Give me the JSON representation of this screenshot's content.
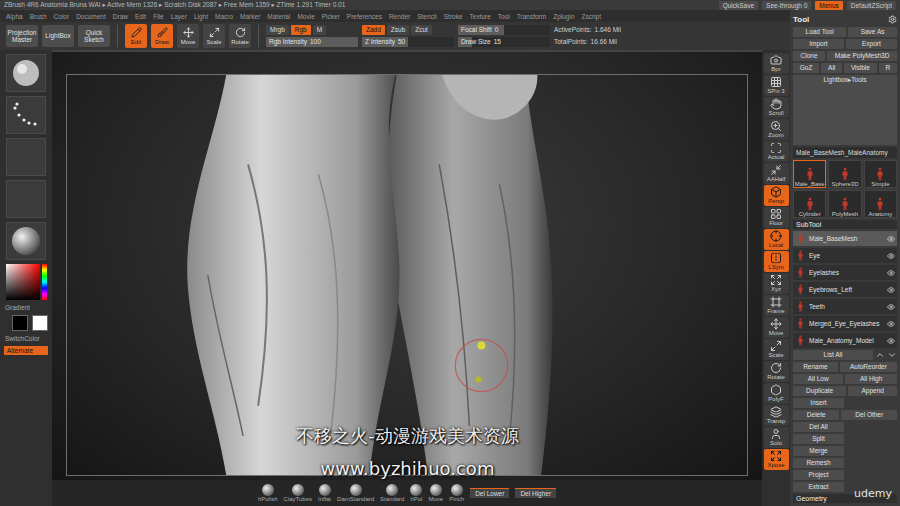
{
  "window": {
    "title": "ZBrush 4R6   Anatomia Bruna WAI  ▸ Active Mem 1326 ▸ Scratch Disk 2087 ▸ Free Mem 1359 ▸ ZTime 1.291 Timer 0.01"
  },
  "title_buttons": [
    {
      "label": "QuickSave",
      "selected": false
    },
    {
      "label": "See-through 0",
      "selected": false
    },
    {
      "label": "Menus",
      "selected": true
    },
    {
      "label": "DefaultZScript",
      "selected": false
    }
  ],
  "menu": [
    "Alpha",
    "Brush",
    "Color",
    "Document",
    "Draw",
    "Edit",
    "File",
    "Layer",
    "Light",
    "Macro",
    "Marker",
    "Material",
    "Movie",
    "Picker",
    "Preferences",
    "Render",
    "Stencil",
    "Stroke",
    "Texture",
    "Tool",
    "Transform",
    "Zplugin",
    "Zscript"
  ],
  "toolbar": {
    "buttons": [
      "Projection Master",
      "LightBox",
      "Quick Sketch"
    ],
    "modes": [
      {
        "label": "Edit",
        "selected": true
      },
      {
        "label": "Draw",
        "selected": true
      },
      {
        "label": "Move",
        "selected": false
      },
      {
        "label": "Scale",
        "selected": false
      },
      {
        "label": "Rotate",
        "selected": false
      }
    ],
    "color_group": {
      "modes": [
        {
          "label": "Mrgb",
          "selected": false
        },
        {
          "label": "Rgb",
          "selected": true
        },
        {
          "label": "M",
          "selected": false
        }
      ],
      "slider": {
        "label": "Rgb Intensity",
        "value": "100",
        "level": 1
      }
    },
    "z_group": {
      "modes": [
        {
          "label": "Zadd",
          "selected": true
        },
        {
          "label": "Zsub",
          "selected": false
        },
        {
          "label": "Zcut",
          "selected": false
        }
      ],
      "slider": {
        "label": "Z Intensity",
        "value": "50",
        "level": 0.5
      }
    },
    "brush_sliders": [
      {
        "label": "Focal Shift",
        "value": "0",
        "level": 0.5
      },
      {
        "label": "Draw Size",
        "value": "15",
        "level": 0.15
      }
    ],
    "stats": [
      {
        "label": "ActivePoints:",
        "value": "1.646 Mil"
      },
      {
        "label": "TotalPoints:",
        "value": "16.66 Mil"
      }
    ]
  },
  "left_shelf": {
    "gradient_label": "Gradient",
    "switch_label": "SwitchColor",
    "alternate": {
      "label": "Alternate",
      "selected": true
    }
  },
  "right_shelf": [
    {
      "label": "Bpr",
      "selected": false
    },
    {
      "label": "SPix 3",
      "selected": false
    },
    {
      "label": "Scroll",
      "selected": false
    },
    {
      "label": "Zoom",
      "selected": false
    },
    {
      "label": "Actual",
      "selected": false
    },
    {
      "label": "AAHalf",
      "selected": false
    },
    {
      "label": "Persp",
      "selected": true
    },
    {
      "label": "Floor",
      "selected": false
    },
    {
      "label": "Local",
      "selected": true
    },
    {
      "label": "LSym",
      "selected": true
    },
    {
      "label": "Xyz",
      "selected": false
    },
    {
      "label": "Frame",
      "selected": false
    },
    {
      "label": "Move",
      "selected": false
    },
    {
      "label": "Scale",
      "selected": false
    },
    {
      "label": "Rotate",
      "selected": false
    },
    {
      "label": "PolyF",
      "selected": false
    },
    {
      "label": "Transp",
      "selected": false
    },
    {
      "label": "Solo",
      "selected": false
    },
    {
      "label": "Xpose",
      "selected": true
    }
  ],
  "bottom_strip": {
    "brushes": [
      "hPolish",
      "ClayTubes",
      "Inflat",
      "DamStandard",
      "Standard",
      "hPol",
      "Move",
      "Pinch"
    ],
    "buttons": [
      "Del Lower",
      "Del Higher"
    ]
  },
  "tool_palette": {
    "title": "Tool",
    "buttons": [
      [
        "Load Tool",
        "Save As"
      ],
      [
        "Import",
        "Export"
      ],
      [
        "Clone",
        "Make PolyMesh3D"
      ],
      [
        "GoZ",
        "All",
        "Visible",
        "R"
      ]
    ],
    "lightbox": "Lightbox▸Tools",
    "current_tool": "Male_BaseMesh_MaleAnatomy",
    "thumbs": [
      {
        "label": "Male_Base",
        "selected": true
      },
      {
        "label": "Sphere3D",
        "selected": false
      },
      {
        "label": "Simple",
        "selected": false
      },
      {
        "label": "Cylinder",
        "selected": false
      },
      {
        "label": "PolyMesh",
        "selected": false
      },
      {
        "label": "Anatomy",
        "selected": false
      }
    ],
    "subtool": {
      "title": "SubTool",
      "items": [
        {
          "name": "Male_BaseMesh",
          "selected": true,
          "visible": true
        },
        {
          "name": "Eye",
          "selected": false,
          "visible": true
        },
        {
          "name": "Eyelashes",
          "selected": false,
          "visible": true
        },
        {
          "name": "Eyebrows_Left",
          "selected": false,
          "visible": true
        },
        {
          "name": "Teeth",
          "selected": false,
          "visible": true
        },
        {
          "name": "Merged_Eye_Eyelashes",
          "selected": false,
          "visible": true
        },
        {
          "name": "Male_Anatomy_Model",
          "selected": false,
          "visible": true
        }
      ]
    },
    "list_all": "List All",
    "controls": [
      [
        "Rename",
        "AutoReorder"
      ],
      [
        "All Low",
        "All High"
      ],
      [
        "Duplicate",
        "Append"
      ],
      [
        "Insert"
      ],
      [
        "Delete",
        "Del Other"
      ],
      [
        "Del All"
      ],
      [
        "Split"
      ],
      [
        "Merge"
      ],
      [
        "Remesh"
      ],
      [
        "Project"
      ],
      [
        "Extract"
      ]
    ],
    "geometry": "Geometry"
  },
  "watermarks": {
    "cn": "不移之火-动漫游戏美术资源",
    "url": "www.byzhihuo.com",
    "brand": "udemy"
  }
}
